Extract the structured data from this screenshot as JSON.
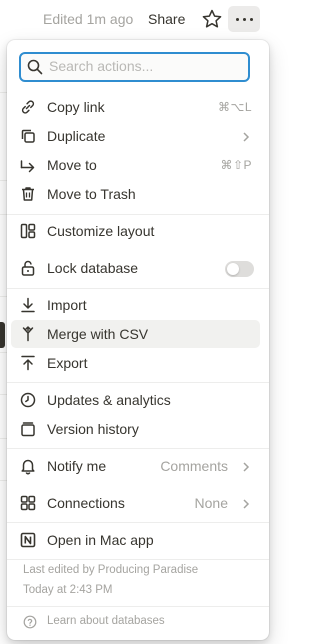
{
  "topbar": {
    "edited": "Edited 1m ago",
    "share": "Share"
  },
  "menu": {
    "search": {
      "placeholder": "Search actions..."
    },
    "items": [
      {
        "label": "Copy link",
        "shortcut": "⌘⌥L",
        "icon": "link-icon"
      },
      {
        "label": "Duplicate",
        "icon": "duplicate-icon"
      },
      {
        "label": "Move to",
        "shortcut": "⌘⇧P",
        "icon": "arrow-right-icon"
      },
      {
        "label": "Move to Trash",
        "icon": "trash-icon"
      },
      {
        "label": "Customize layout",
        "icon": "layout-icon"
      },
      {
        "label": "Lock database",
        "icon": "lock-icon",
        "toggle_on": false
      },
      {
        "label": "Import",
        "icon": "import-icon"
      },
      {
        "label": "Merge with CSV",
        "icon": "merge-icon"
      },
      {
        "label": "Export",
        "icon": "export-icon"
      },
      {
        "label": "Updates & analytics",
        "icon": "clock-icon"
      },
      {
        "label": "Version history",
        "icon": "history-icon"
      },
      {
        "label": "Notify me",
        "value": "Comments",
        "icon": "bell-icon"
      },
      {
        "label": "Connections",
        "value": "None",
        "icon": "connections-icon"
      },
      {
        "label": "Open in Mac app",
        "icon": "notion-app-icon"
      }
    ],
    "meta": {
      "last_edited": "Last edited by Producing Paradise",
      "time": "Today at 2:43 PM"
    },
    "learn": "Learn about databases"
  },
  "colors": {
    "focus_ring": "#2f8dd0",
    "hover_bg": "#f1f1ef",
    "muted_text": "#a5a4a0",
    "text": "#37352f"
  }
}
